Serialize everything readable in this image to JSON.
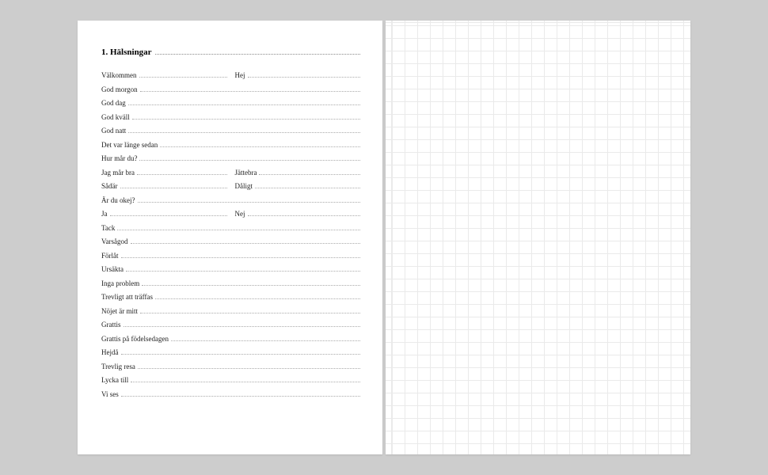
{
  "heading": "1. Hälsningar",
  "rows": [
    [
      {
        "term": "Välkommen"
      },
      {
        "term": "Hej"
      }
    ],
    [
      {
        "term": "God morgon"
      }
    ],
    [
      {
        "term": "God dag"
      }
    ],
    [
      {
        "term": "God kväll"
      }
    ],
    [
      {
        "term": "God natt"
      }
    ],
    [
      {
        "term": "Det var länge sedan"
      }
    ],
    [
      {
        "term": "Hur mår du?"
      }
    ],
    [
      {
        "term": "Jag mår bra"
      },
      {
        "term": "Jättebra"
      }
    ],
    [
      {
        "term": "Sådär"
      },
      {
        "term": "Dåligt"
      }
    ],
    [
      {
        "term": "Är du okej?"
      }
    ],
    [
      {
        "term": "Ja"
      },
      {
        "term": "Nej"
      }
    ],
    [
      {
        "term": "Tack"
      }
    ],
    [
      {
        "term": "Varsågod"
      }
    ],
    [
      {
        "term": "Förlåt"
      }
    ],
    [
      {
        "term": "Ursäkta"
      }
    ],
    [
      {
        "term": "Inga problem"
      }
    ],
    [
      {
        "term": "Trevligt att träffas"
      }
    ],
    [
      {
        "term": "Nöjet är mitt"
      }
    ],
    [
      {
        "term": "Grattis"
      }
    ],
    [
      {
        "term": "Grattis på födelsedagen"
      }
    ],
    [
      {
        "term": "Hejdå"
      }
    ],
    [
      {
        "term": "Trevlig resa"
      }
    ],
    [
      {
        "term": "Lycka till"
      }
    ],
    [
      {
        "term": "Vi ses"
      }
    ]
  ]
}
